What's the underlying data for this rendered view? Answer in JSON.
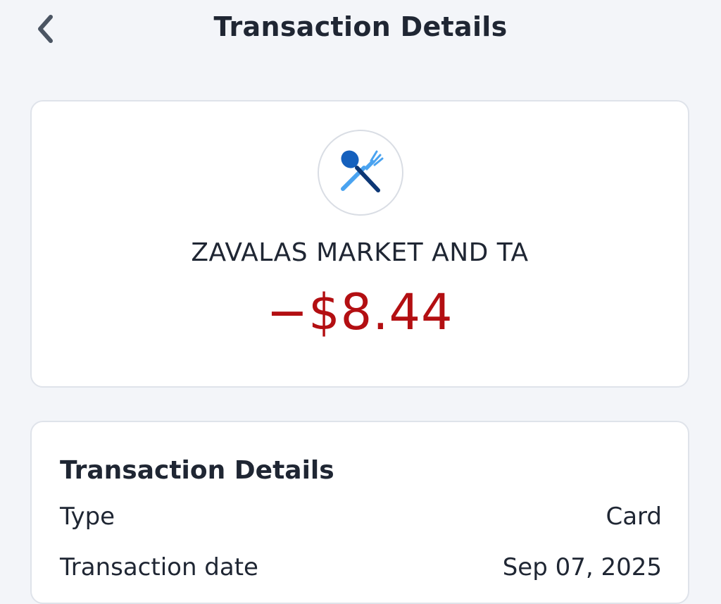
{
  "header": {
    "back_icon": "chevron-left-icon",
    "title": "Transaction Details"
  },
  "summary": {
    "category_icon": "utensils-icon",
    "merchant_name": "ZAVALAS MARKET AND TA",
    "amount": "−$8.44",
    "amount_color": "#b30f12"
  },
  "details": {
    "section_title": "Transaction Details",
    "rows": [
      {
        "label": "Type",
        "value": "Card"
      },
      {
        "label": "Transaction date",
        "value": "Sep 07, 2025"
      }
    ]
  },
  "colors": {
    "background": "#f3f5f9",
    "card": "#ffffff",
    "text": "#1f2633",
    "icon_blue_dark": "#1560bd",
    "icon_blue_light": "#4aa3f0",
    "icon_navy": "#0d3775"
  }
}
